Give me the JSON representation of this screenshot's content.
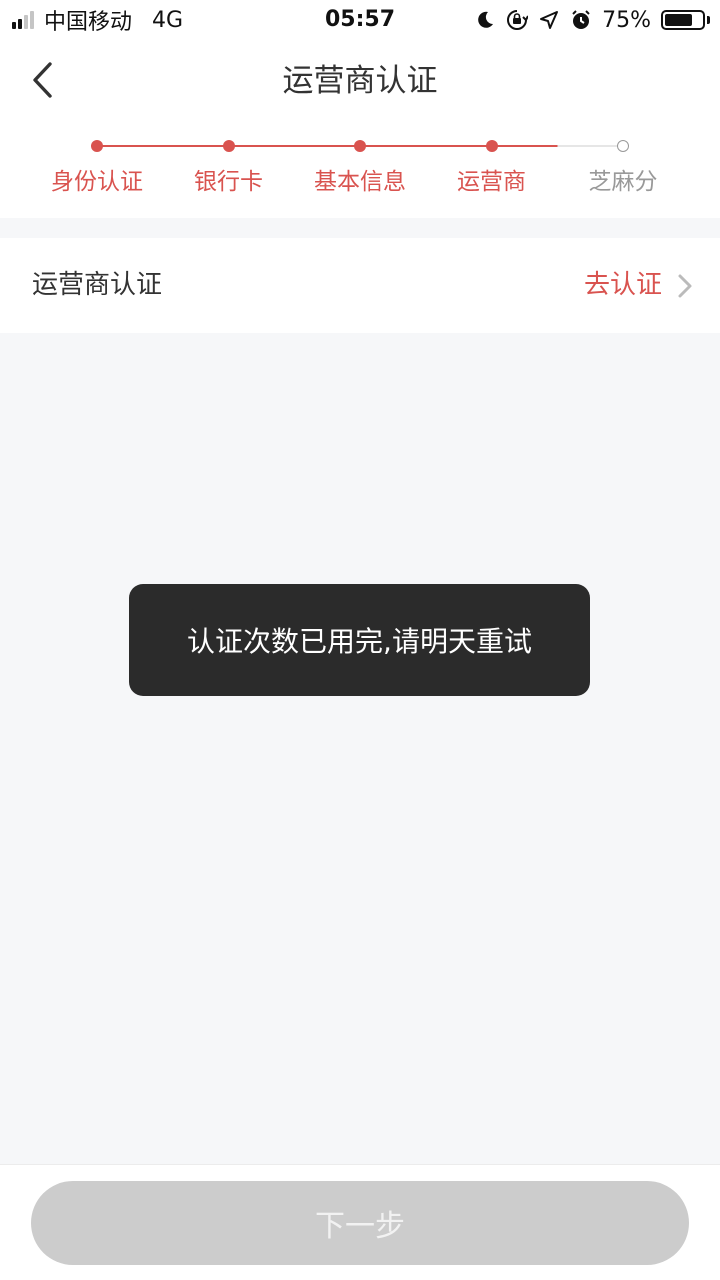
{
  "colors": {
    "accent": "#d9534f",
    "inactive": "#999999",
    "inactive_line": "#e6e6e6",
    "button_bg": "#cccccc",
    "button_text": "#f2f2f2"
  },
  "status_bar": {
    "carrier": "中国移动",
    "network": "4G",
    "time": "05:57",
    "battery": "75%",
    "battery_level": 0.75,
    "icons": [
      "moon-icon",
      "rotation-lock-icon",
      "location-icon",
      "alarm-icon"
    ]
  },
  "nav": {
    "title": "运营商认证",
    "back_icon": "chevron-left-icon"
  },
  "steps": [
    {
      "label": "身份认证",
      "done": true
    },
    {
      "label": "银行卡",
      "done": true
    },
    {
      "label": "基本信息",
      "done": true
    },
    {
      "label": "运营商",
      "done": true
    },
    {
      "label": "芝麻分",
      "done": false
    }
  ],
  "row": {
    "label": "运营商认证",
    "action": "去认证",
    "chevron_icon": "chevron-right-icon"
  },
  "toast": {
    "message": "认证次数已用完,请明天重试"
  },
  "bottom": {
    "next_label": "下一步"
  }
}
